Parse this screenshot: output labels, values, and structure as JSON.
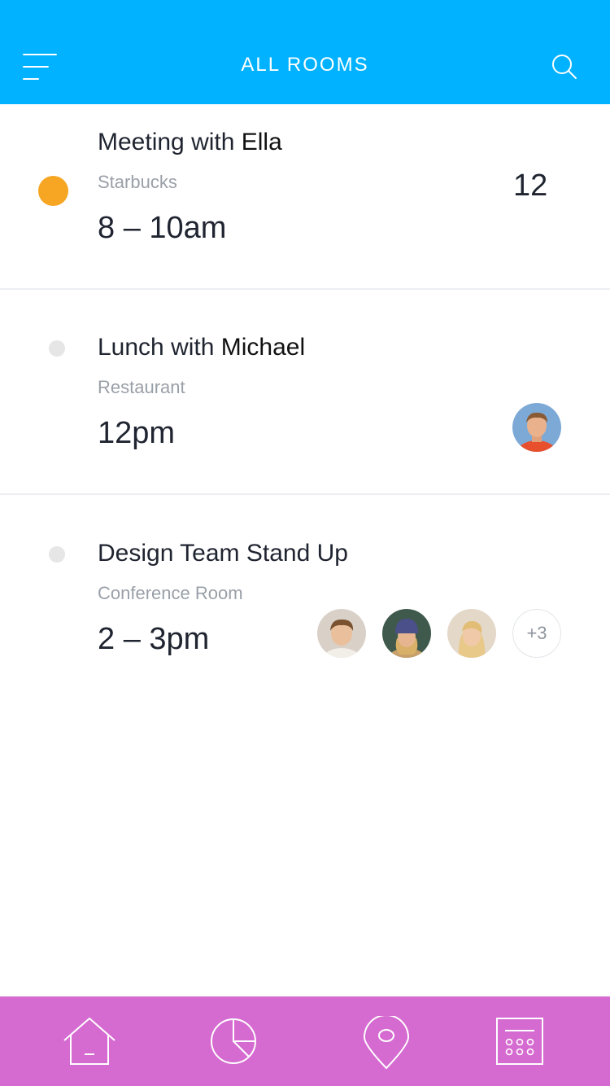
{
  "header": {
    "title": "ALL ROOMS",
    "menu_icon": "hamburger-menu-icon",
    "search_icon": "search-icon",
    "background_color": "#00b2ff"
  },
  "events": [
    {
      "title_prefix": "Meeting with ",
      "title_name": "Ella",
      "location": "Starbucks",
      "time": "8 – 10am",
      "count": "12",
      "indicator_color": "#f6a623",
      "active": true
    },
    {
      "title_prefix": "Lunch with ",
      "title_name": "Michael",
      "location": "Restaurant",
      "time": "12pm",
      "indicator_color": "#e6e6e6",
      "active": false,
      "attendees": [
        "Michael"
      ]
    },
    {
      "title_prefix": "Design Team Stand Up",
      "title_name": "",
      "location": "Conference Room",
      "time": "2 – 3pm",
      "indicator_color": "#e6e6e6",
      "active": false,
      "more_attendees": "+3"
    }
  ],
  "tabbar": {
    "background_color": "#d56ad0",
    "tabs": [
      {
        "icon": "home-icon"
      },
      {
        "icon": "pie-chart-icon"
      },
      {
        "icon": "location-pin-icon"
      },
      {
        "icon": "calendar-icon"
      }
    ]
  }
}
